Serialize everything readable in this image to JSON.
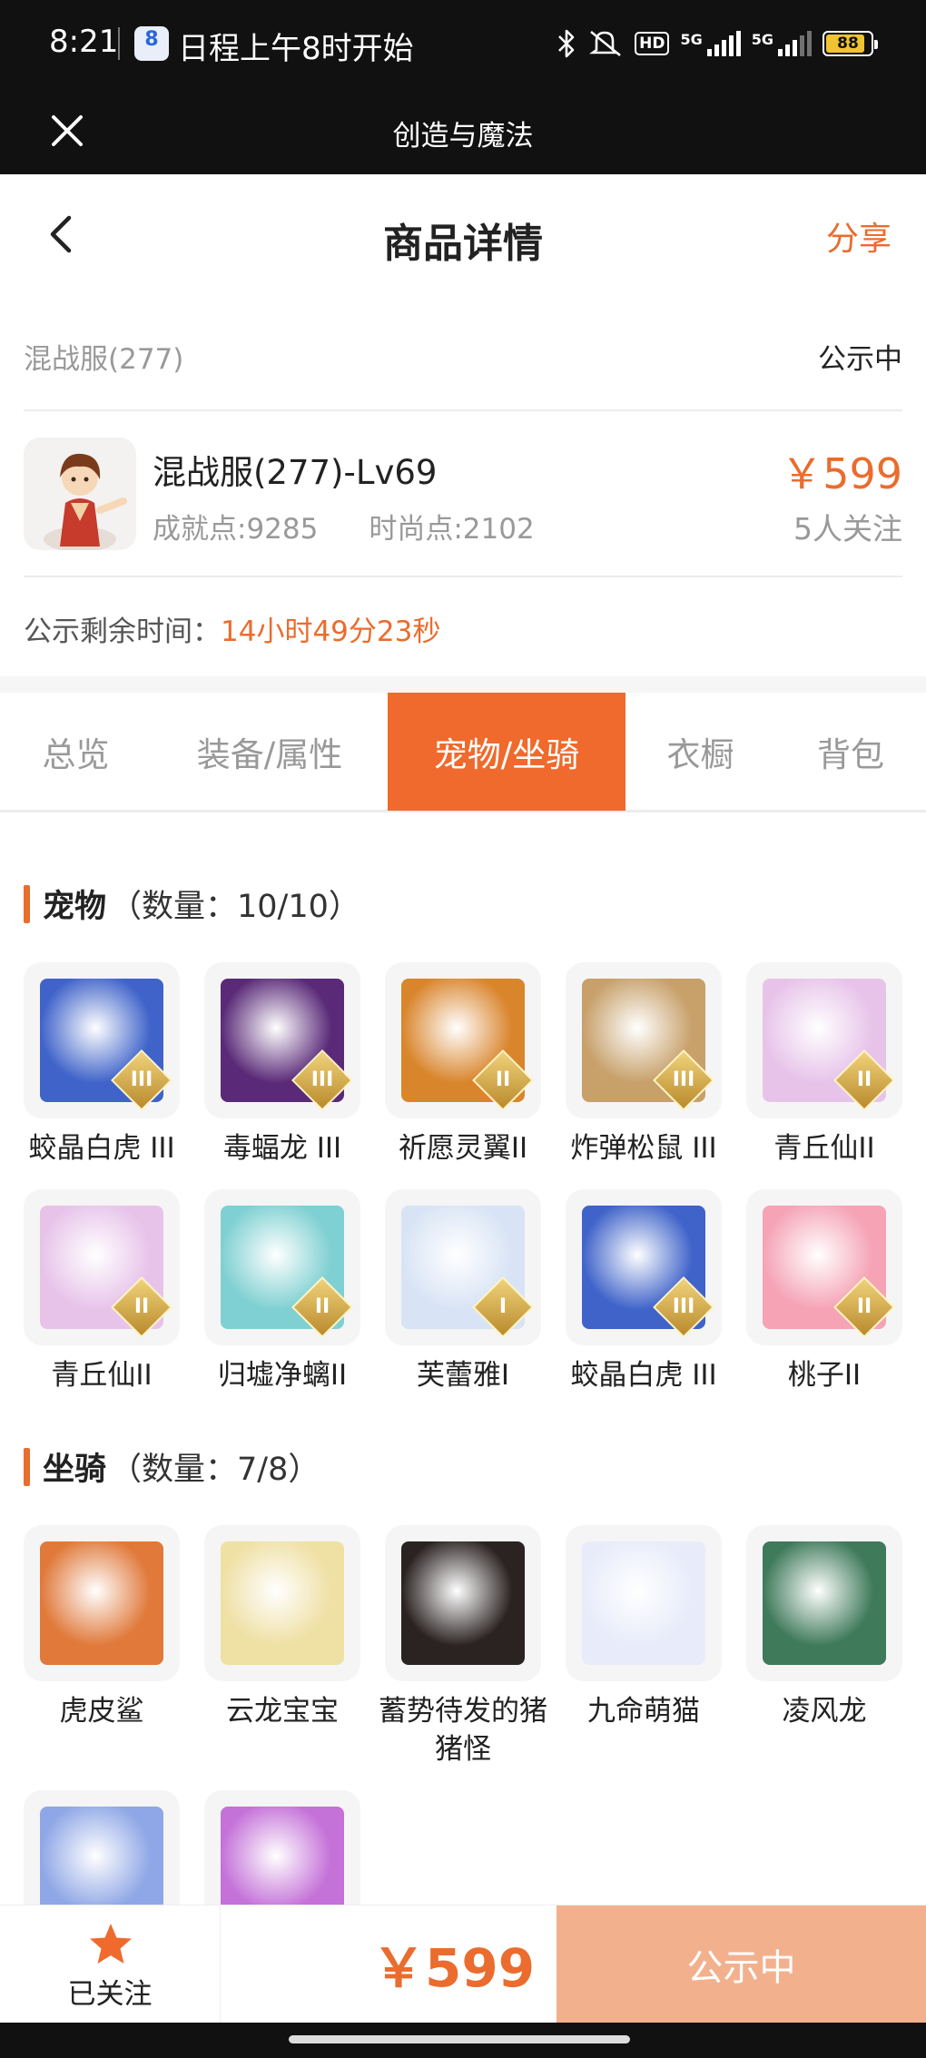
{
  "status_bar": {
    "time": "8:21",
    "calendar_day": "8",
    "notification": "日程上午8时开始",
    "hd": "HD",
    "net1": "5G",
    "net2": "5G",
    "battery": "88"
  },
  "app_bar": {
    "title": "创造与魔法"
  },
  "header": {
    "title": "商品详情",
    "share_label": "分享"
  },
  "listing": {
    "server": "混战服(277)",
    "status": "公示中",
    "title": "混战服(277)-Lv69",
    "achievement": "成就点:9285",
    "fashion": "时尚点:2102",
    "price": "￥599",
    "followers": "5人关注",
    "remain_label": "公示剩余时间：",
    "remain_value": "14小时49分23秒"
  },
  "tabs": [
    {
      "label": "总览",
      "active": false
    },
    {
      "label": "装备/属性",
      "active": false
    },
    {
      "label": "宠物/坐骑",
      "active": true
    },
    {
      "label": "衣橱",
      "active": false
    },
    {
      "label": "背包",
      "active": false
    }
  ],
  "pets": {
    "title": "宠物",
    "count": "（数量：10/10）",
    "items": [
      {
        "name": "蛟晶白虎 III",
        "badge": "III",
        "color": "#3f63c9"
      },
      {
        "name": "毒蝠龙 III",
        "badge": "III",
        "color": "#5a2a78"
      },
      {
        "name": "祈愿灵翼II",
        "badge": "II",
        "color": "#d9852c"
      },
      {
        "name": "炸弹松鼠 III",
        "badge": "III",
        "color": "#c7a06a"
      },
      {
        "name": "青丘仙II",
        "badge": "II",
        "color": "#e7c3ea"
      },
      {
        "name": "青丘仙II",
        "badge": "II",
        "color": "#e7c3ea"
      },
      {
        "name": "归墟净螭II",
        "badge": "II",
        "color": "#7fd0d2"
      },
      {
        "name": "芙蕾雅I",
        "badge": "I",
        "color": "#d8e4f5"
      },
      {
        "name": "蛟晶白虎 III",
        "badge": "III",
        "color": "#3f63c9"
      },
      {
        "name": "桃子II",
        "badge": "II",
        "color": "#f5a3b5"
      }
    ]
  },
  "mounts": {
    "title": "坐骑",
    "count": "（数量：7/8）",
    "items": [
      {
        "name": "虎皮鲨",
        "color": "#e0793a"
      },
      {
        "name": "云龙宝宝",
        "color": "#efe0a4"
      },
      {
        "name": "蓄势待发的猪猪怪",
        "color": "#2a2322"
      },
      {
        "name": "九命萌猫",
        "color": "#e8ecfa"
      },
      {
        "name": "凌风龙",
        "color": "#3f7a5a"
      },
      {
        "name": "",
        "color": "#8fa7e6"
      },
      {
        "name": "",
        "color": "#c471d8"
      }
    ]
  },
  "bottom": {
    "fav_label": "已关注",
    "price": "￥599",
    "button_label": "公示中"
  }
}
